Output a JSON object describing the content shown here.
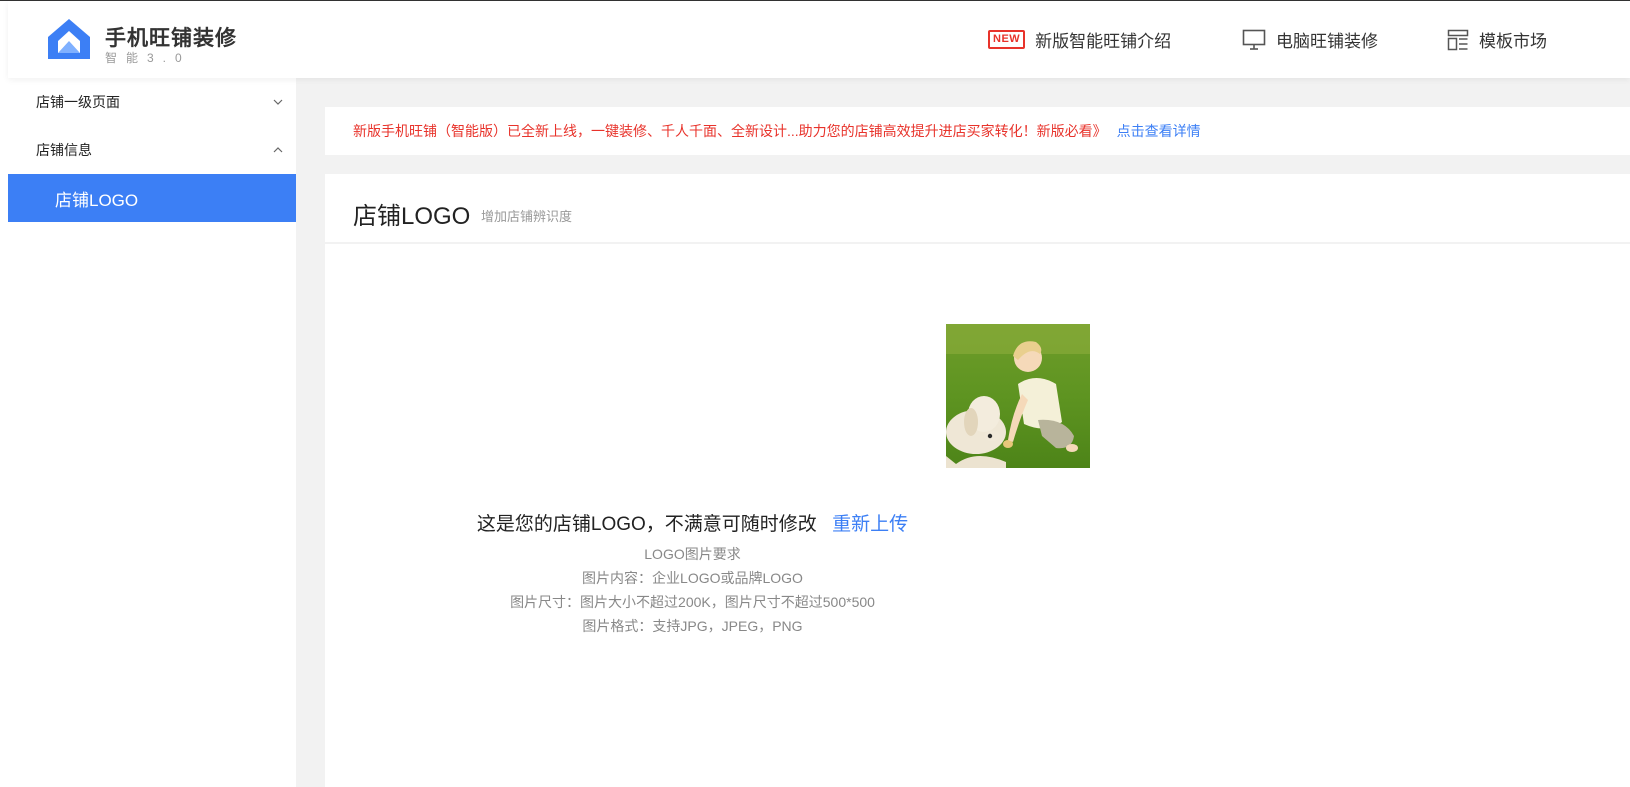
{
  "header": {
    "brand_title": "手机旺铺装修",
    "brand_sub": "智能3.0",
    "nav": [
      {
        "badge": "NEW",
        "label": "新版智能旺铺介绍"
      },
      {
        "icon": "monitor-icon",
        "label": "电脑旺铺装修"
      },
      {
        "icon": "template-icon",
        "label": "模板市场"
      }
    ]
  },
  "sidebar": {
    "groups": [
      {
        "label": "店铺一级页面",
        "expanded": false
      },
      {
        "label": "店铺信息",
        "expanded": true
      }
    ],
    "active_item": "店铺LOGO"
  },
  "notice": {
    "text": "新版手机旺铺（智能版）已全新上线，一键装修、千人千面、全新设计...助力您的店铺高效提升进店买家转化！新版必看》",
    "link": "点击查看详情"
  },
  "panel": {
    "title": "店铺LOGO",
    "subtitle": "增加店铺辨识度",
    "caption": "这是您的店铺LOGO，不满意可随时修改",
    "reupload": "重新上传",
    "requirements": [
      "LOGO图片要求",
      "图片内容：企业LOGO或品牌LOGO",
      "图片尺寸：图片大小不超过200K，图片尺寸不超过500*500",
      "图片格式：支持JPG，JPEG，PNG"
    ]
  },
  "colors": {
    "accent": "#3c7ff5",
    "notice_red": "#e8332b",
    "page_bg": "#f2f2f2"
  }
}
